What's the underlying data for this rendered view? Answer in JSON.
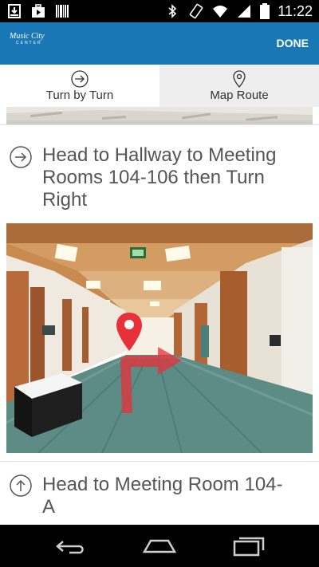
{
  "status_bar": {
    "time": "11:22",
    "left_icons": [
      "download-icon",
      "briefcase-icon",
      "barcode-icon"
    ],
    "right_icons": [
      "bluetooth-icon",
      "rotate-icon",
      "wifi-icon",
      "signal-icon",
      "battery-icon"
    ]
  },
  "app_bar": {
    "logo_line1": "Music City",
    "logo_line2": "CENTER",
    "done_label": "DONE"
  },
  "tabs": [
    {
      "label": "Turn by Turn",
      "icon": "arrow-right-circle-icon",
      "selected": true
    },
    {
      "label": "Map Route",
      "icon": "map-pin-icon",
      "selected": false
    }
  ],
  "steps": [
    {
      "text": "Head  to Hallway to Meeting Rooms 104-106 then Turn Right",
      "icon": "arrow-right-circle-icon"
    },
    {
      "text": "Head  to Meeting Room 104-A",
      "icon": "arrow-up-circle-icon"
    }
  ],
  "photo": {
    "marker": "map-pin-icon",
    "direction_arrow": "turn-right-arrow-icon",
    "accent": "#e8303a"
  },
  "colors": {
    "app_bar": "#1a77b6",
    "tab_inactive": "#eeeeee",
    "step_text": "#555555"
  },
  "nav_bar": [
    "back-icon",
    "home-icon",
    "recent-apps-icon"
  ]
}
